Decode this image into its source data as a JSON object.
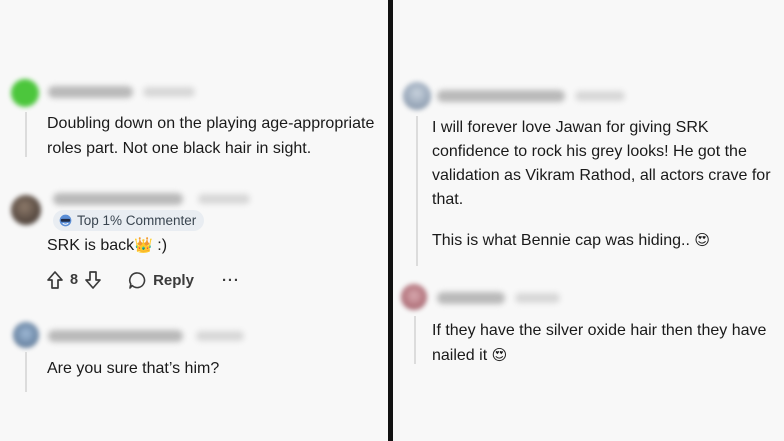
{
  "left_panel": {
    "comments": [
      {
        "text": "Doubling down on the playing age-appropriate roles part. Not one black hair in sight."
      },
      {
        "flair": "Top 1% Commenter",
        "text": "SRK is back",
        "text_emoji": "👑",
        "text_suffix": " :)",
        "actions": {
          "vote_count": "8",
          "reply_label": "Reply",
          "more_label": "···"
        }
      },
      {
        "text": "Are you sure that’s him?"
      }
    ]
  },
  "right_panel": {
    "comments": [
      {
        "text": "I will forever love Jawan for giving SRK confidence to rock his grey looks! He got the validation as Vikram Rathod, all actors crave for that.",
        "text2": "This is what Bennie cap was hiding..",
        "text2_emoji": "😍"
      },
      {
        "text": "If they have the silver oxide hair then they have nailed it",
        "text_emoji": "😍"
      }
    ]
  },
  "icons": [
    "upvote-icon",
    "downvote-icon",
    "reply-bubble-icon",
    "more-icon",
    "commenter-badge-icon"
  ],
  "colors": {
    "background": "#f8f8f8",
    "divider": "#111111",
    "text": "#1a1a1a",
    "badge_bg": "#e9edf2",
    "avatar_green": "#46c83a"
  }
}
